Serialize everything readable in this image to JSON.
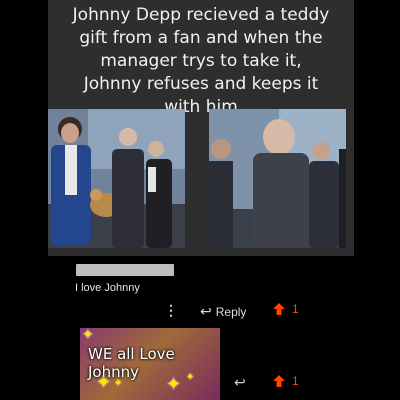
{
  "post": {
    "caption_lines": [
      "Johnny Depp recieved a teddy",
      "gift from a fan and when the",
      "manager trys to take it,",
      "Johnny refuses and keeps it",
      "with him"
    ]
  },
  "comment": {
    "text": "I love Johnny",
    "reply_label": "Reply",
    "upvotes": "1"
  },
  "reply_comment": {
    "sticker_text": "WE all Love Johnny",
    "upvotes": "1"
  },
  "colors": {
    "upvote": "#ff4500",
    "card_background": "#2e2e2e"
  },
  "icons": [
    "more-vertical-icon",
    "reply-arrow-icon",
    "upvote-arrow-icon",
    "sparkle-icon"
  ]
}
